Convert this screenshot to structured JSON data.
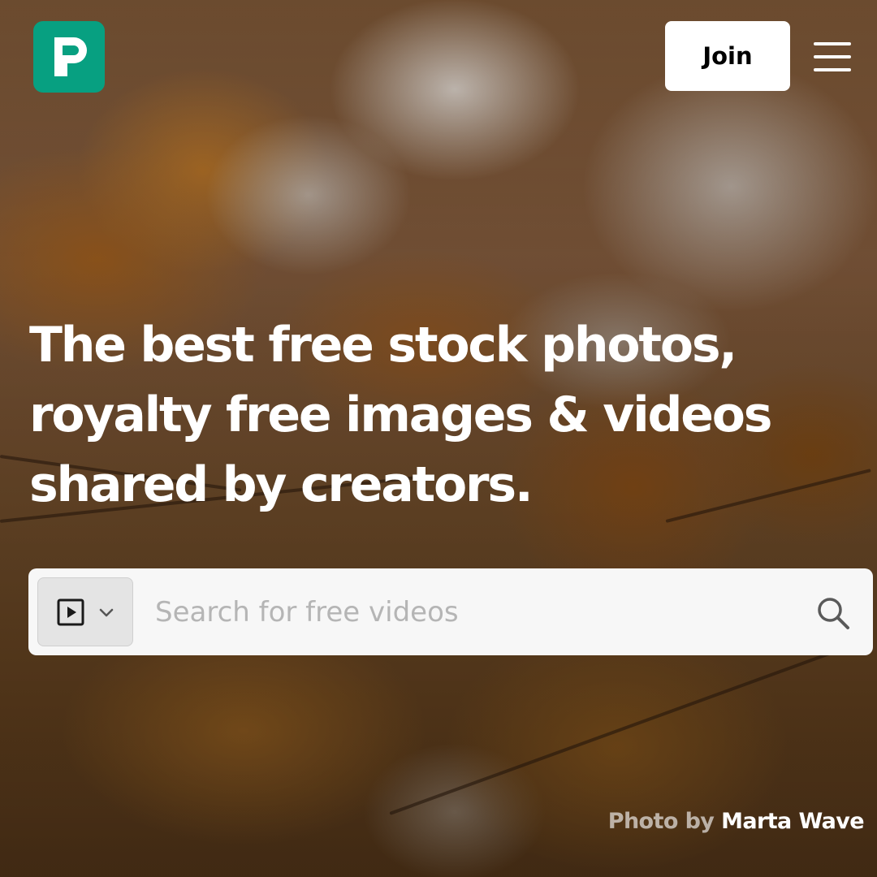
{
  "header": {
    "logo_icon": "pexels-logo-icon",
    "brand_color": "#07a081",
    "join_label": "Join",
    "menu_icon": "hamburger-menu-icon"
  },
  "hero": {
    "headline_lines": [
      "The best free stock photos,",
      "royalty free images & videos",
      "shared by creators."
    ]
  },
  "search": {
    "type_icon": "video-play-icon",
    "type_dropdown_icon": "chevron-down-icon",
    "placeholder": "Search for free videos",
    "value": "",
    "submit_icon": "search-icon"
  },
  "credit": {
    "prefix": "Photo by",
    "author": "Marta Wave"
  }
}
